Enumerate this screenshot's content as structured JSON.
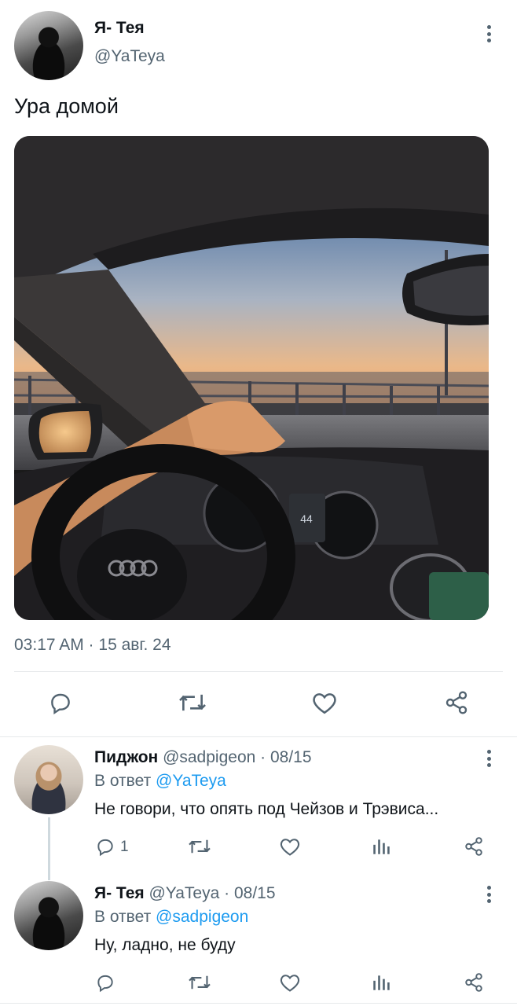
{
  "tweet": {
    "author_name": "Я- Тея",
    "author_handle": "@YaTeya",
    "text": "Ура домой",
    "image_alt": "Вид из салона автомобиля на закат",
    "timestamp": "03:17 AM · 15 авг. 24"
  },
  "replies": [
    {
      "author_name": "Пиджон",
      "author_handle": "@sadpigeon",
      "date": "· 08/15",
      "reply_to_prefix": "В ответ",
      "reply_to_handle": "@YaTeya",
      "text": "Не говори, что опять под Чейзов и Трэвиса...",
      "reply_count": "1"
    },
    {
      "author_name": "Я- Тея",
      "author_handle": "@YaTeya",
      "date": "· 08/15",
      "reply_to_prefix": "В ответ",
      "reply_to_handle": "@sadpigeon",
      "text": "Ну, ладно, не буду",
      "reply_count": ""
    }
  ],
  "colors": {
    "accent": "#1d9bf0",
    "secondary_text": "#536471",
    "divider": "#e6e9eb"
  },
  "icons": [
    "reply-icon",
    "retweet-icon",
    "like-icon",
    "share-icon",
    "views-icon",
    "more-icon"
  ]
}
